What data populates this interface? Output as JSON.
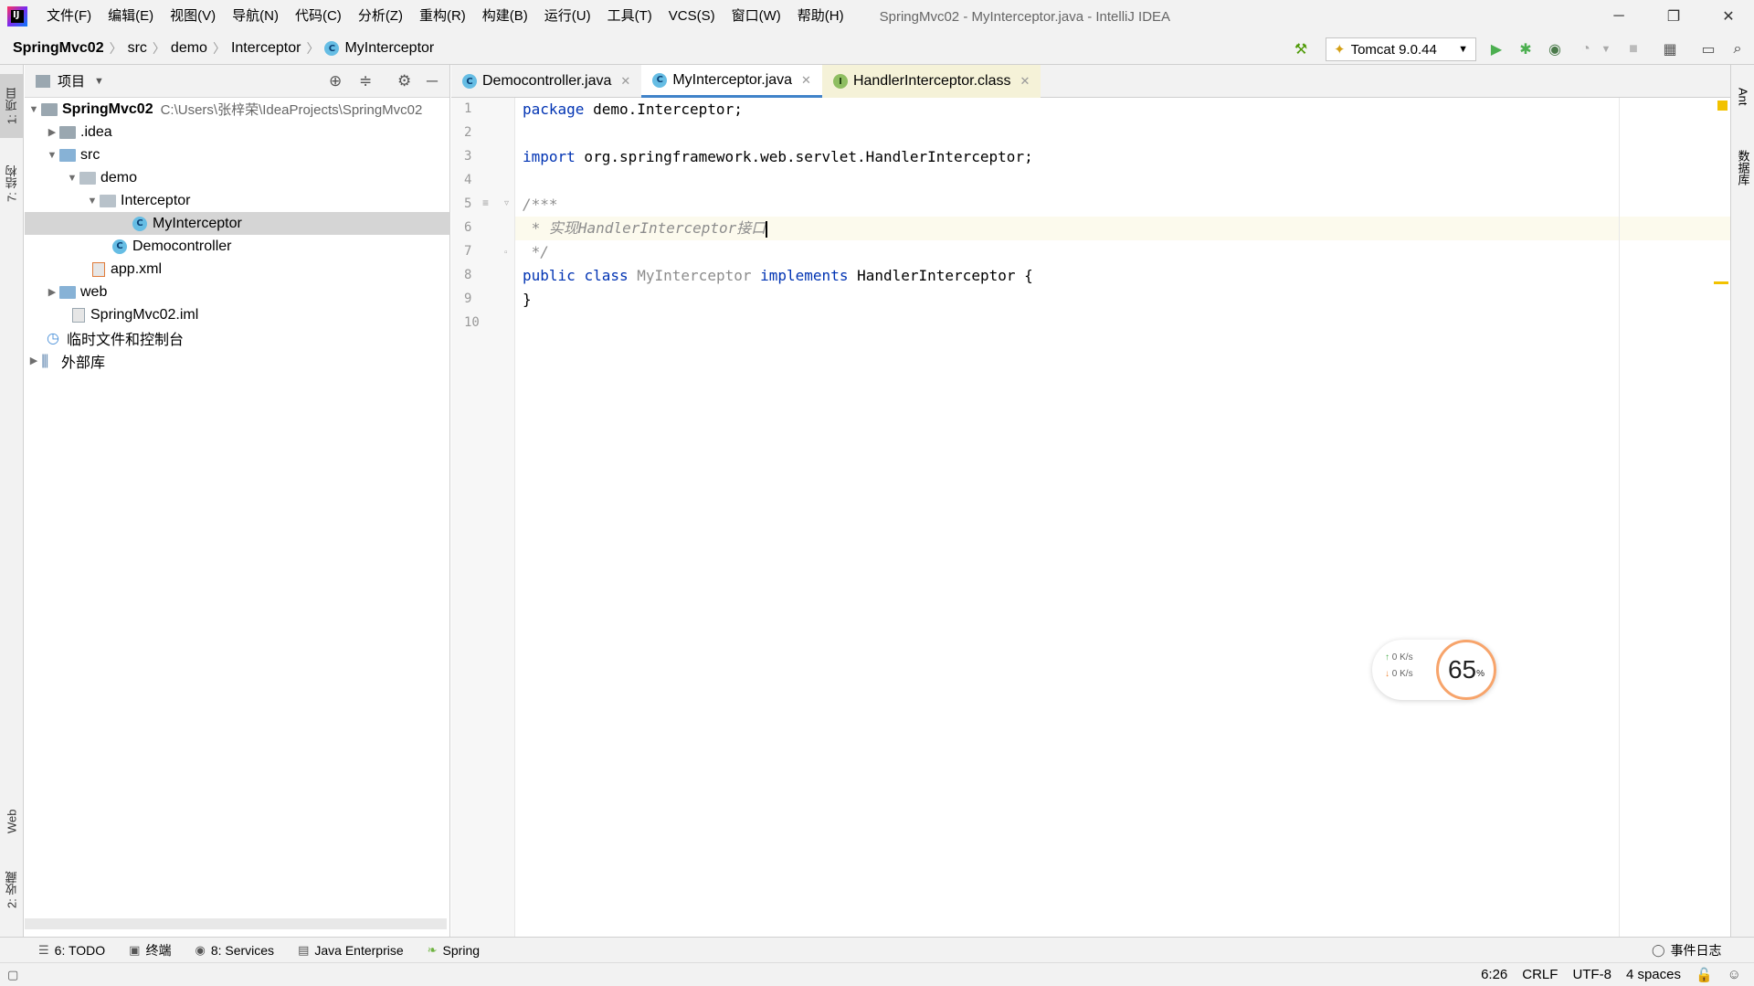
{
  "menu": {
    "items": [
      "文件(F)",
      "编辑(E)",
      "视图(V)",
      "导航(N)",
      "代码(C)",
      "分析(Z)",
      "重构(R)",
      "构建(B)",
      "运行(U)",
      "工具(T)",
      "VCS(S)",
      "窗口(W)",
      "帮助(H)"
    ],
    "window_title": "SpringMvc02 - MyInterceptor.java - IntelliJ IDEA"
  },
  "breadcrumb": [
    "SpringMvc02",
    "src",
    "demo",
    "Interceptor",
    "MyInterceptor"
  ],
  "toolbar": {
    "run_config": "Tomcat 9.0.44"
  },
  "left_strip": {
    "project_tab": "1: 项目",
    "structure_tab": "7: 结构",
    "web_tab": "Web",
    "favorites_tab": "2: 收藏"
  },
  "right_strip": {
    "ant_tab": "Ant",
    "database_tab": "数据库"
  },
  "project": {
    "title": "项目",
    "root_name": "SpringMvc02",
    "root_path": "C:\\Users\\张梓荣\\IdeaProjects\\SpringMvc02",
    "nodes": {
      "idea": ".idea",
      "src": "src",
      "demo": "demo",
      "interceptor": "Interceptor",
      "myinterceptor": "MyInterceptor",
      "democontroller": "Democontroller",
      "appxml": "app.xml",
      "web": "web",
      "iml": "SpringMvc02.iml",
      "scratches": "临时文件和控制台",
      "libraries": "外部库"
    }
  },
  "editor": {
    "tabs": [
      {
        "label": "Democontroller.java"
      },
      {
        "label": "MyInterceptor.java"
      },
      {
        "label": "HandlerInterceptor.class"
      }
    ],
    "line_numbers": [
      "1",
      "2",
      "3",
      "4",
      "5",
      "6",
      "7",
      "8",
      "9",
      "10"
    ],
    "code": {
      "l1_kw": "package",
      "l1_rest": " demo.Interceptor;",
      "l3_kw": "import",
      "l3_rest": " org.springframework.web.servlet.HandlerInterceptor;",
      "l5": "/***",
      "l6": " * 实现HandlerInterceptor接口",
      "l7": " */",
      "l8_kw1": "public",
      "l8_kw2": "class",
      "l8_name": "MyInterceptor",
      "l8_kw3": "implements",
      "l8_rest": " HandlerInterceptor {",
      "l9": "}"
    }
  },
  "net_widget": {
    "up": "0  K/s",
    "down": "0  K/s",
    "percent": "65",
    "percent_sign": "%"
  },
  "bottom_tabs": [
    {
      "label": "6: TODO"
    },
    {
      "label": "终端"
    },
    {
      "label": "8: Services"
    },
    {
      "label": "Java Enterprise"
    },
    {
      "label": "Spring"
    }
  ],
  "event_log": "事件日志",
  "status": {
    "position": "6:26",
    "line_sep": "CRLF",
    "encoding": "UTF-8",
    "indent": "4 spaces"
  }
}
